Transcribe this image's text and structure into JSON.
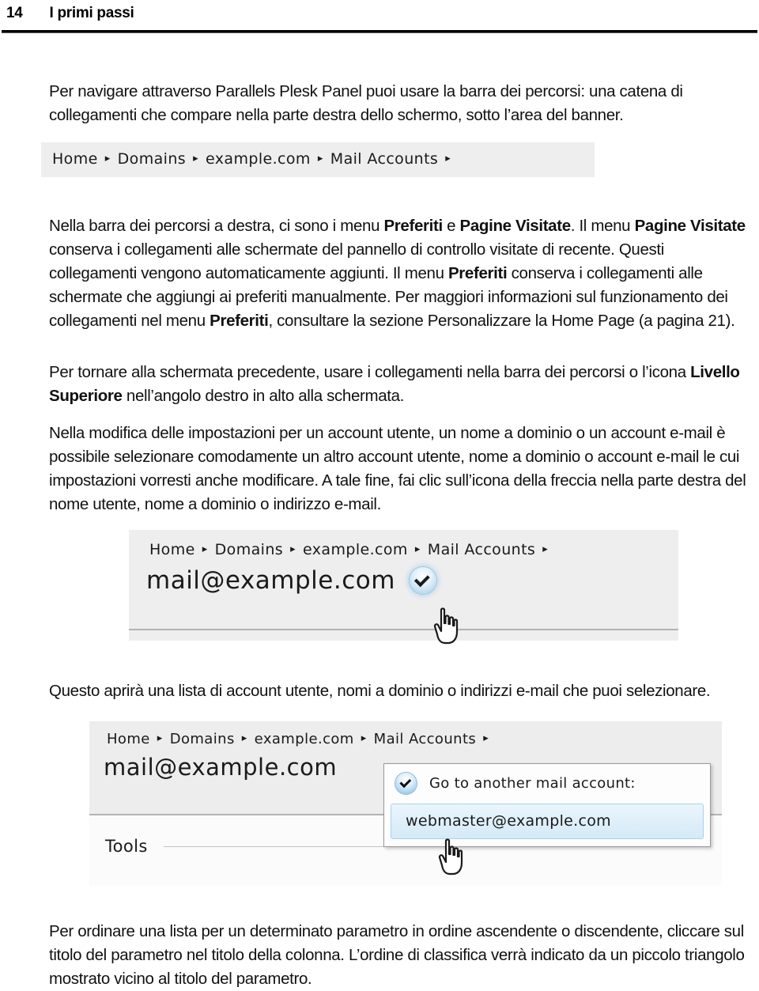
{
  "header": {
    "page_number": "14",
    "title": "I primi passi"
  },
  "paragraphs": {
    "p1": "Per navigare attraverso Parallels Plesk Panel puoi usare la barra dei percorsi: una catena di collegamenti che compare nella parte destra dello schermo, sotto l’area del banner.",
    "p2_a": "Nella barra dei percorsi a destra, ci sono i menu ",
    "p2_b1": "Preferiti",
    "p2_c": " e ",
    "p2_b2": "Pagine Visitate",
    "p2_d": ". Il menu ",
    "p2_b3": "Pagine Visitate",
    "p2_e": " conserva i collegamenti alle schermate del pannello di controllo visitate di recente. Questi collegamenti vengono automaticamente aggiunti. Il menu ",
    "p2_b4": "Preferiti",
    "p2_f": " conserva i collegamenti alle schermate che aggiungi ai preferiti manualmente. Per maggiori informazioni sul funzionamento dei collegamenti nel menu ",
    "p2_b5": "Preferiti",
    "p2_g": ", consultare la sezione Personalizzare la Home Page (a pagina 21).",
    "p3_a": "Per tornare alla schermata precedente, usare i collegamenti nella barra dei percorsi o l’icona ",
    "p3_b": "Livello Superiore",
    "p3_c": " nell’angolo destro in alto alla schermata.",
    "p4": "Nella modifica delle impostazioni per un account utente, un nome a dominio o un account e-mail è possibile selezionare comodamente un altro account utente, nome a dominio o account e-mail le cui impostazioni vorresti anche modificare. A tale fine, fai clic sull’icona della freccia nella parte destra del nome utente, nome a dominio o indirizzo e-mail.",
    "p5": "Questo aprirà una lista di account utente, nomi a dominio o indirizzi e-mail che puoi selezionare.",
    "p6": "Per ordinare una lista per un determinato parametro in ordine ascendente o discendente, cliccare sul titolo del parametro nel titolo della colonna. L’ordine di classifica verrà indicato da un piccolo triangolo mostrato vicino al titolo del parametro."
  },
  "figure_breadcrumb": {
    "crumbs": [
      "Home",
      "Domains",
      "example.com",
      "Mail Accounts"
    ],
    "separator": "▸"
  },
  "figure_account": {
    "crumbs": [
      "Home",
      "Domains",
      "example.com",
      "Mail Accounts"
    ],
    "separator": "▸",
    "account": "mail@example.com"
  },
  "figure_dropdown": {
    "crumbs": [
      "Home",
      "Domains",
      "example.com",
      "Mail Accounts"
    ],
    "separator": "▸",
    "account": "mail@example.com",
    "dropdown_title": "Go to another mail account:",
    "dropdown_items": [
      "webmaster@example.com"
    ],
    "tools_label": "Tools"
  },
  "colors": {
    "panel_background": "#ededed",
    "page_background": "#ffffff",
    "highlight_item": "#d4eaf7",
    "accent_blue": "#9fcde9",
    "rule": "#b3b3b3"
  }
}
